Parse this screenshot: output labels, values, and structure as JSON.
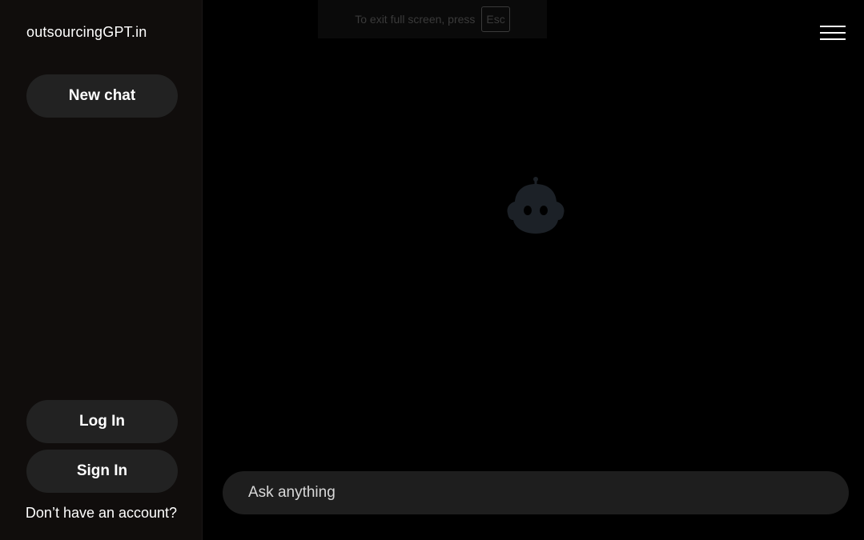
{
  "sidebar": {
    "brand": "outsourcingGPT.in",
    "new_chat_label": "New chat",
    "login_label": "Log In",
    "signin_label": "Sign In",
    "account_prompt": "Don’t have an account?"
  },
  "fullscreen_notice": {
    "text": "To exit full screen, press",
    "key": "Esc"
  },
  "header": {
    "menu_icon": "hamburger-menu-icon"
  },
  "main": {
    "logo_icon": "robot-icon"
  },
  "composer": {
    "placeholder": "Ask anything",
    "value": ""
  },
  "colors": {
    "background": "#000000",
    "sidebar": "#100d0c",
    "button": "#222222",
    "composer": "#1e1e1e",
    "robot": "#1c2127"
  }
}
